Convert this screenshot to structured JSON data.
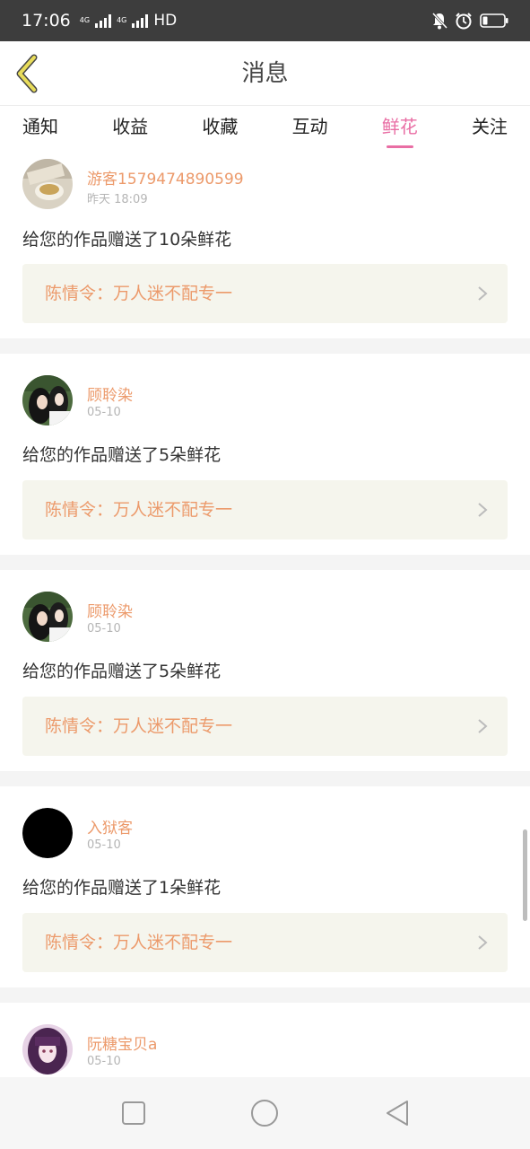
{
  "status_bar": {
    "time": "17:06",
    "network_1": "4G",
    "network_2": "4G",
    "hd_label": "HD",
    "icons": [
      "signal-icon",
      "signal-icon",
      "mute-bell-icon",
      "alarm-icon",
      "battery-icon"
    ]
  },
  "header": {
    "title": "消息",
    "back_icon": "chevron-left-icon",
    "accent_color": "#e8dc5a"
  },
  "tabs": [
    {
      "label": "通知",
      "active": false
    },
    {
      "label": "收益",
      "active": false
    },
    {
      "label": "收藏",
      "active": false
    },
    {
      "label": "互动",
      "active": false
    },
    {
      "label": "鲜花",
      "active": true
    },
    {
      "label": "关注",
      "active": false
    }
  ],
  "feed": [
    {
      "username": "游客1579474890599",
      "time": "昨天 18:09",
      "message": "给您的作品赠送了10朵鲜花",
      "work_title": "陈情令：万人迷不配专一",
      "avatar": "tea-cup-photo"
    },
    {
      "username": "顾聆染",
      "time": "05-10",
      "message": "给您的作品赠送了5朵鲜花",
      "work_title": "陈情令：万人迷不配专一",
      "avatar": "two-people-photo"
    },
    {
      "username": "顾聆染",
      "time": "05-10",
      "message": "给您的作品赠送了5朵鲜花",
      "work_title": "陈情令：万人迷不配专一",
      "avatar": "two-people-photo"
    },
    {
      "username": "入狱客",
      "time": "05-10",
      "message": "给您的作品赠送了1朵鲜花",
      "work_title": "陈情令：万人迷不配专一",
      "avatar": "black-circle"
    },
    {
      "username": "阮糖宝贝a",
      "time": "05-10",
      "message": "",
      "work_title": "",
      "avatar": "anime-girl-photo"
    }
  ],
  "colors": {
    "accent_pink": "#e96ea4",
    "username_orange": "#ec9a6b",
    "link_background": "#f5f5ed"
  },
  "nav_bar": {
    "icons": [
      "recents-square-icon",
      "home-circle-icon",
      "back-triangle-icon"
    ]
  }
}
